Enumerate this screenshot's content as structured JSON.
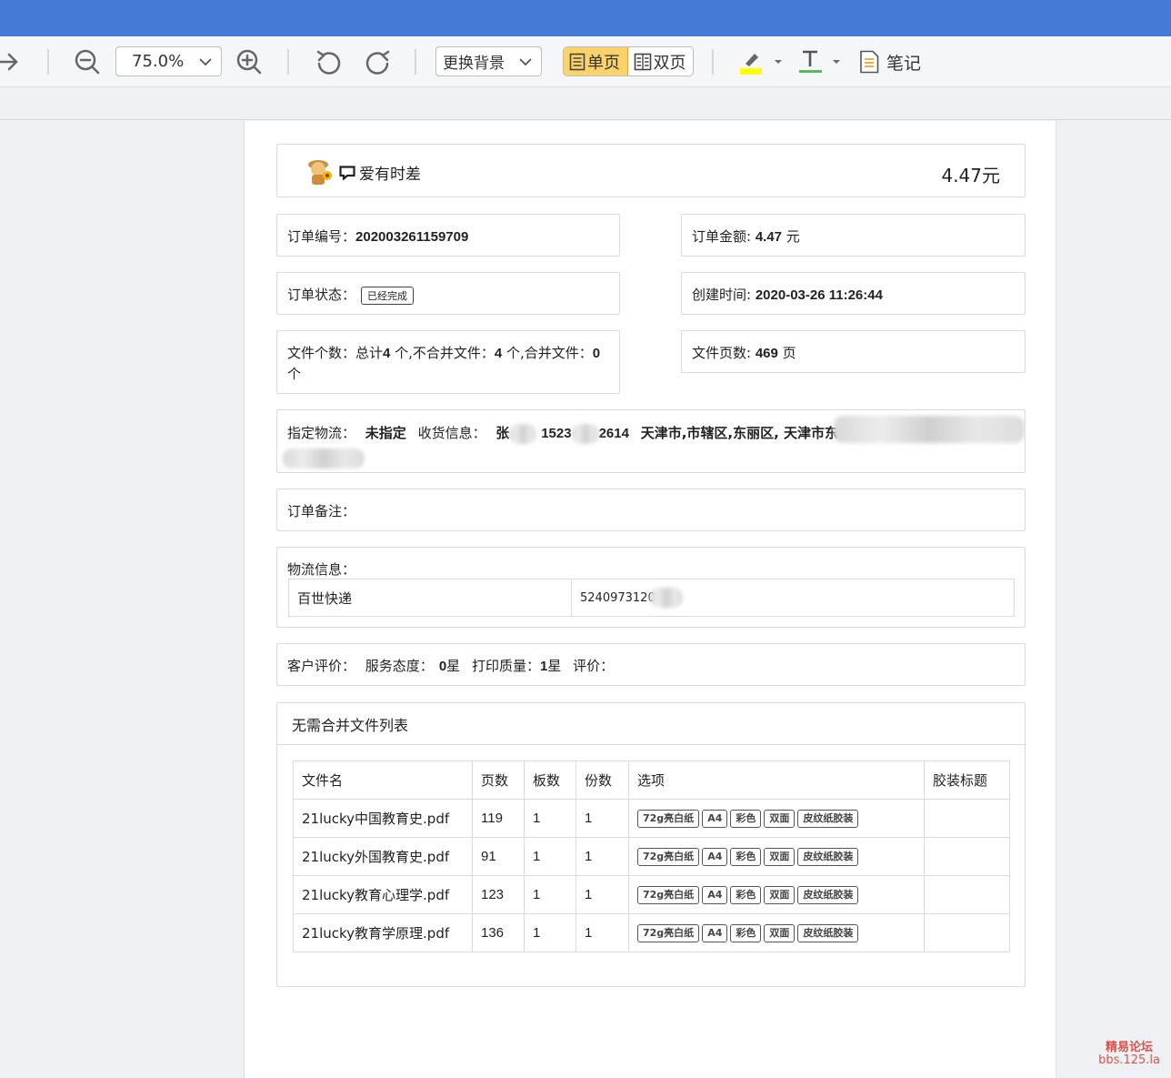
{
  "toolbar": {
    "zoom_value": "75.0%",
    "background_label": "更换背景",
    "single_page_label": "单页",
    "double_page_label": "双页",
    "note_label": "笔记",
    "highlight_color": "#ffff00",
    "text_color": "#5cb85c"
  },
  "shop": {
    "name": "爱有时差",
    "price": "4.47元"
  },
  "order": {
    "number_label": "订单编号：",
    "number_value": "202003261159709",
    "amount_label": "订单金额: ",
    "amount_value": "4.47",
    "amount_unit": " 元",
    "status_label": "订单状态：",
    "status_value": "已经完成",
    "created_label": "创建时间: ",
    "created_value": "2020-03-26 11:26:44",
    "files_label": "文件个数：总计",
    "files_total": "4",
    "files_mid1": " 个,不合并文件：",
    "files_nomerge": "4",
    "files_mid2": " 个,合并文件：",
    "files_merge": "0",
    "files_unit": " 个",
    "pages_label": "文件页数: ",
    "pages_value": "469",
    "pages_unit": " 页",
    "logistics_label": "指定物流：",
    "logistics_value": "未指定",
    "receiver_label": "收货信息：",
    "receiver_part1": "张",
    "receiver_phone1": "1523",
    "receiver_phone2": "2614",
    "receiver_address": "天津市,市辖区,东丽区, 天津市东丽",
    "remark_label": "订单备注：",
    "tracking_label": "物流信息：",
    "courier": "百世快递",
    "tracking_no": "5240973120",
    "rating_label": "客户评价：",
    "service_label": "服务态度：",
    "service_value": "0",
    "service_unit": "星",
    "quality_label": "打印质量：",
    "quality_value": "1",
    "quality_unit": "星",
    "comment_label": "评价："
  },
  "file_list": {
    "title": "无需合并文件列表",
    "headers": [
      "文件名",
      "页数",
      "板数",
      "份数",
      "选项",
      "胶装标题"
    ],
    "rows": [
      {
        "name": "21lucky中国教育史.pdf",
        "pages": "119",
        "plates": "1",
        "copies": "1",
        "options": [
          "72g亮白纸",
          "A4",
          "彩色",
          "双面",
          "皮纹纸胶装"
        ],
        "binding_title": ""
      },
      {
        "name": "21lucky外国教育史.pdf",
        "pages": "91",
        "plates": "1",
        "copies": "1",
        "options": [
          "72g亮白纸",
          "A4",
          "彩色",
          "双面",
          "皮纹纸胶装"
        ],
        "binding_title": ""
      },
      {
        "name": "21lucky教育心理学.pdf",
        "pages": "123",
        "plates": "1",
        "copies": "1",
        "options": [
          "72g亮白纸",
          "A4",
          "彩色",
          "双面",
          "皮纹纸胶装"
        ],
        "binding_title": ""
      },
      {
        "name": "21lucky教育学原理.pdf",
        "pages": "136",
        "plates": "1",
        "copies": "1",
        "options": [
          "72g亮白纸",
          "A4",
          "彩色",
          "双面",
          "皮纹纸胶装"
        ],
        "binding_title": ""
      }
    ]
  },
  "watermark": {
    "line1": "精易论坛",
    "line2": "bbs.125.la"
  }
}
